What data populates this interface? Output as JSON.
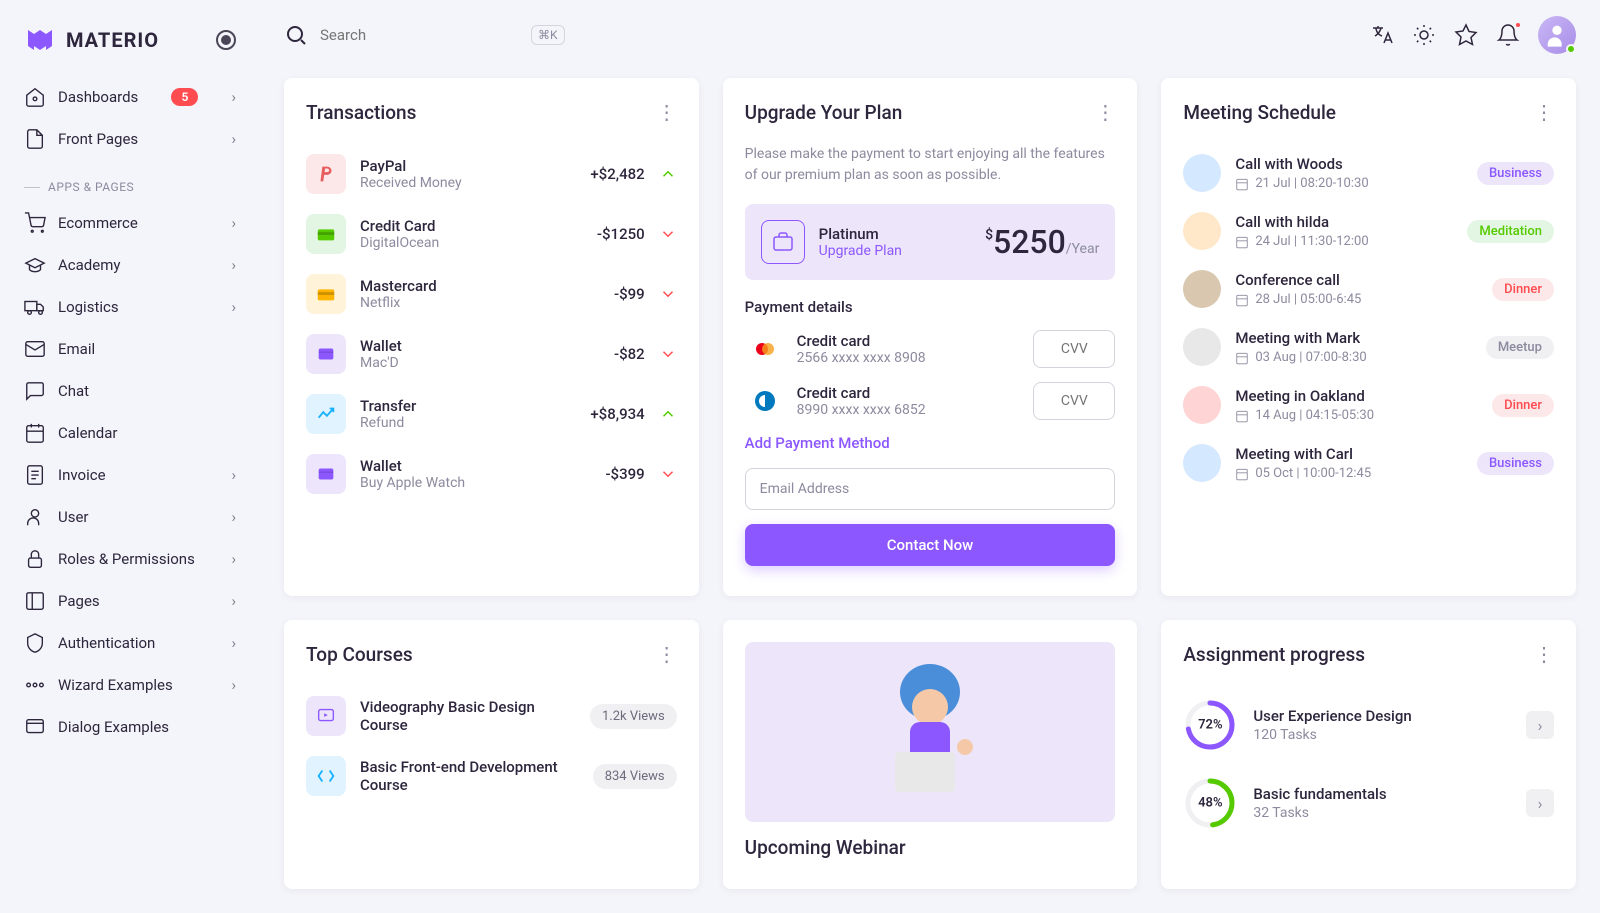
{
  "brand": "MATERIO",
  "search": {
    "placeholder": "Search",
    "kbd": "⌘K"
  },
  "nav": {
    "dashboards": {
      "label": "Dashboards",
      "badge": "5"
    },
    "frontPages": {
      "label": "Front Pages"
    },
    "section1": "APPS & PAGES",
    "ecommerce": {
      "label": "Ecommerce"
    },
    "academy": {
      "label": "Academy"
    },
    "logistics": {
      "label": "Logistics"
    },
    "email": {
      "label": "Email"
    },
    "chat": {
      "label": "Chat"
    },
    "calendar": {
      "label": "Calendar"
    },
    "invoice": {
      "label": "Invoice"
    },
    "user": {
      "label": "User"
    },
    "roles": {
      "label": "Roles & Permissions"
    },
    "pages": {
      "label": "Pages"
    },
    "auth": {
      "label": "Authentication"
    },
    "wizard": {
      "label": "Wizard Examples"
    },
    "dialog": {
      "label": "Dialog Examples"
    }
  },
  "transactions": {
    "title": "Transactions",
    "items": [
      {
        "name": "PayPal",
        "sub": "Received Money",
        "amount": "+$2,482",
        "iconBg": "#fce8e8",
        "iconColor": "#e85d5d",
        "up": true
      },
      {
        "name": "Credit Card",
        "sub": "DigitalOcean",
        "amount": "-$1250",
        "iconBg": "#e3f6e3",
        "iconColor": "#56ca00",
        "up": false
      },
      {
        "name": "Mastercard",
        "sub": "Netflix",
        "amount": "-$99",
        "iconBg": "#fff3d9",
        "iconColor": "#ffb400",
        "up": false
      },
      {
        "name": "Wallet",
        "sub": "Mac'D",
        "amount": "-$82",
        "iconBg": "#ede6fb",
        "iconColor": "#8c57ff",
        "up": false
      },
      {
        "name": "Transfer",
        "sub": "Refund",
        "amount": "+$8,934",
        "iconBg": "#e0f3ff",
        "iconColor": "#16b1ff",
        "up": true
      },
      {
        "name": "Wallet",
        "sub": "Buy Apple Watch",
        "amount": "-$399",
        "iconBg": "#ece5fb",
        "iconColor": "#8c57ff",
        "up": false
      }
    ]
  },
  "upgrade": {
    "title": "Upgrade Your Plan",
    "desc": "Please make the payment to start enjoying all the features of our premium plan as soon as possible.",
    "planName": "Platinum",
    "planLink": "Upgrade Plan",
    "planAmount": "5250",
    "planPeriod": "/Year",
    "payTitle": "Payment details",
    "cards": [
      {
        "name": "Credit card",
        "num": "2566 xxxx xxxx 8908",
        "cvv": "CVV"
      },
      {
        "name": "Credit card",
        "num": "8990 xxxx xxxx 6852",
        "cvv": "CVV"
      }
    ],
    "addPayment": "Add Payment Method",
    "emailPlaceholder": "Email Address",
    "contactBtn": "Contact Now"
  },
  "meetings": {
    "title": "Meeting Schedule",
    "items": [
      {
        "name": "Call with Woods",
        "date": "21 Jul | 08:20-10:30",
        "badge": "Business",
        "badgeBg": "#ede6fb",
        "badgeColor": "#8c57ff",
        "avatarBg": "#d4e8ff"
      },
      {
        "name": "Call with hilda",
        "date": "24 Jul | 11:30-12:00",
        "badge": "Meditation",
        "badgeBg": "#e3f6e3",
        "badgeColor": "#56ca00",
        "avatarBg": "#ffe8c9"
      },
      {
        "name": "Conference call",
        "date": "28 Jul | 05:00-6:45",
        "badge": "Dinner",
        "badgeBg": "#fce8e8",
        "badgeColor": "#ff4c51",
        "avatarBg": "#d9c7b0"
      },
      {
        "name": "Meeting with Mark",
        "date": "03 Aug | 07:00-8:30",
        "badge": "Meetup",
        "badgeBg": "#f0f0f3",
        "badgeColor": "#8c8a9e",
        "avatarBg": "#e8e8e8"
      },
      {
        "name": "Meeting in Oakland",
        "date": "14 Aug | 04:15-05:30",
        "badge": "Dinner",
        "badgeBg": "#fce8e8",
        "badgeColor": "#ff4c51",
        "avatarBg": "#ffd4d4"
      },
      {
        "name": "Meeting with Carl",
        "date": "05 Oct | 10:00-12:45",
        "badge": "Business",
        "badgeBg": "#ede6fb",
        "badgeColor": "#8c57ff",
        "avatarBg": "#d4e8ff"
      }
    ]
  },
  "courses": {
    "title": "Top Courses",
    "items": [
      {
        "name": "Videography Basic Design Course",
        "views": "1.2k Views",
        "iconBg": "#ede6fb",
        "iconColor": "#8c57ff"
      },
      {
        "name": "Basic Front-end Development Course",
        "views": "834 Views",
        "iconBg": "#e0f3ff",
        "iconColor": "#16b1ff"
      }
    ]
  },
  "webinar": {
    "title": "Upcoming Webinar"
  },
  "assignments": {
    "title": "Assignment progress",
    "items": [
      {
        "percent": "72%",
        "name": "User Experience Design",
        "tasks": "120 Tasks",
        "color": "#8c57ff",
        "dash": 72
      },
      {
        "percent": "48%",
        "name": "Basic fundamentals",
        "tasks": "32 Tasks",
        "color": "#56ca00",
        "dash": 48
      }
    ]
  }
}
